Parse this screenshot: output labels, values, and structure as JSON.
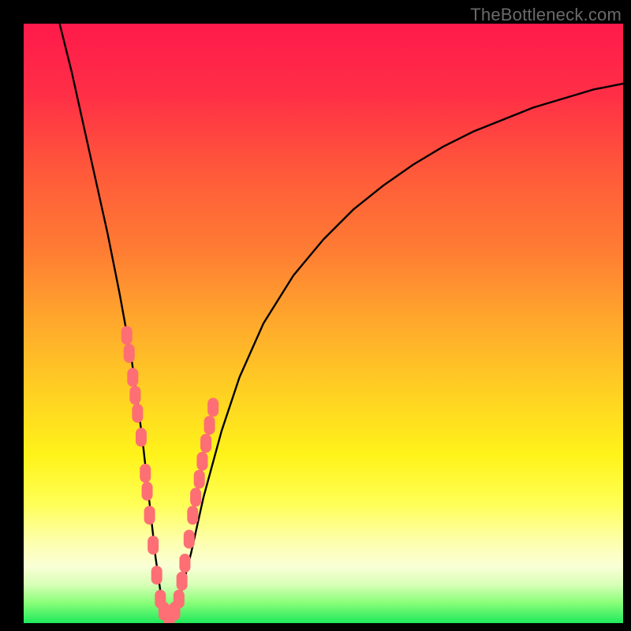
{
  "watermark": "TheBottleneck.com",
  "gradient": {
    "stops": [
      {
        "offset": 0.0,
        "color": "#ff1a4b"
      },
      {
        "offset": 0.12,
        "color": "#ff2f46"
      },
      {
        "offset": 0.25,
        "color": "#ff5a3a"
      },
      {
        "offset": 0.38,
        "color": "#ff7d33"
      },
      {
        "offset": 0.5,
        "color": "#ffa92c"
      },
      {
        "offset": 0.62,
        "color": "#ffd222"
      },
      {
        "offset": 0.72,
        "color": "#fff31a"
      },
      {
        "offset": 0.8,
        "color": "#ffff55"
      },
      {
        "offset": 0.86,
        "color": "#fdffa8"
      },
      {
        "offset": 0.905,
        "color": "#faffd6"
      },
      {
        "offset": 0.935,
        "color": "#d9ffb8"
      },
      {
        "offset": 0.965,
        "color": "#8cff7a"
      },
      {
        "offset": 1.0,
        "color": "#1fe95c"
      }
    ]
  },
  "chart_data": {
    "type": "line",
    "title": "",
    "xlabel": "",
    "ylabel": "",
    "xlim": [
      0,
      100
    ],
    "ylim": [
      0,
      100
    ],
    "grid": false,
    "series": [
      {
        "name": "bottleneck-curve",
        "x": [
          6,
          8,
          10,
          12,
          14,
          16,
          18,
          19,
          20,
          21,
          22,
          23,
          24,
          25,
          26,
          28,
          30,
          33,
          36,
          40,
          45,
          50,
          55,
          60,
          65,
          70,
          75,
          80,
          85,
          90,
          95,
          100
        ],
        "y": [
          100,
          92,
          83,
          74,
          65,
          55,
          44,
          37,
          29,
          20,
          11,
          4,
          1,
          1,
          4,
          12,
          21,
          32,
          41,
          50,
          58,
          64,
          69,
          73,
          76.5,
          79.5,
          82,
          84,
          86,
          87.5,
          89,
          90
        ]
      }
    ],
    "scatter": {
      "name": "sample-points",
      "color": "#fd6f74",
      "points": [
        {
          "x": 17.2,
          "y": 48
        },
        {
          "x": 17.6,
          "y": 45
        },
        {
          "x": 18.2,
          "y": 41
        },
        {
          "x": 18.6,
          "y": 38
        },
        {
          "x": 19.0,
          "y": 35
        },
        {
          "x": 19.6,
          "y": 31
        },
        {
          "x": 20.3,
          "y": 25
        },
        {
          "x": 20.6,
          "y": 22
        },
        {
          "x": 21.0,
          "y": 18
        },
        {
          "x": 21.6,
          "y": 13
        },
        {
          "x": 22.2,
          "y": 8
        },
        {
          "x": 22.8,
          "y": 4
        },
        {
          "x": 23.4,
          "y": 2
        },
        {
          "x": 24.3,
          "y": 1
        },
        {
          "x": 25.2,
          "y": 2
        },
        {
          "x": 25.9,
          "y": 4
        },
        {
          "x": 26.4,
          "y": 7
        },
        {
          "x": 26.9,
          "y": 10
        },
        {
          "x": 27.6,
          "y": 14
        },
        {
          "x": 28.2,
          "y": 18
        },
        {
          "x": 28.7,
          "y": 21
        },
        {
          "x": 29.3,
          "y": 24
        },
        {
          "x": 29.8,
          "y": 27
        },
        {
          "x": 30.4,
          "y": 30
        },
        {
          "x": 31.0,
          "y": 33
        },
        {
          "x": 31.6,
          "y": 36
        }
      ]
    }
  }
}
